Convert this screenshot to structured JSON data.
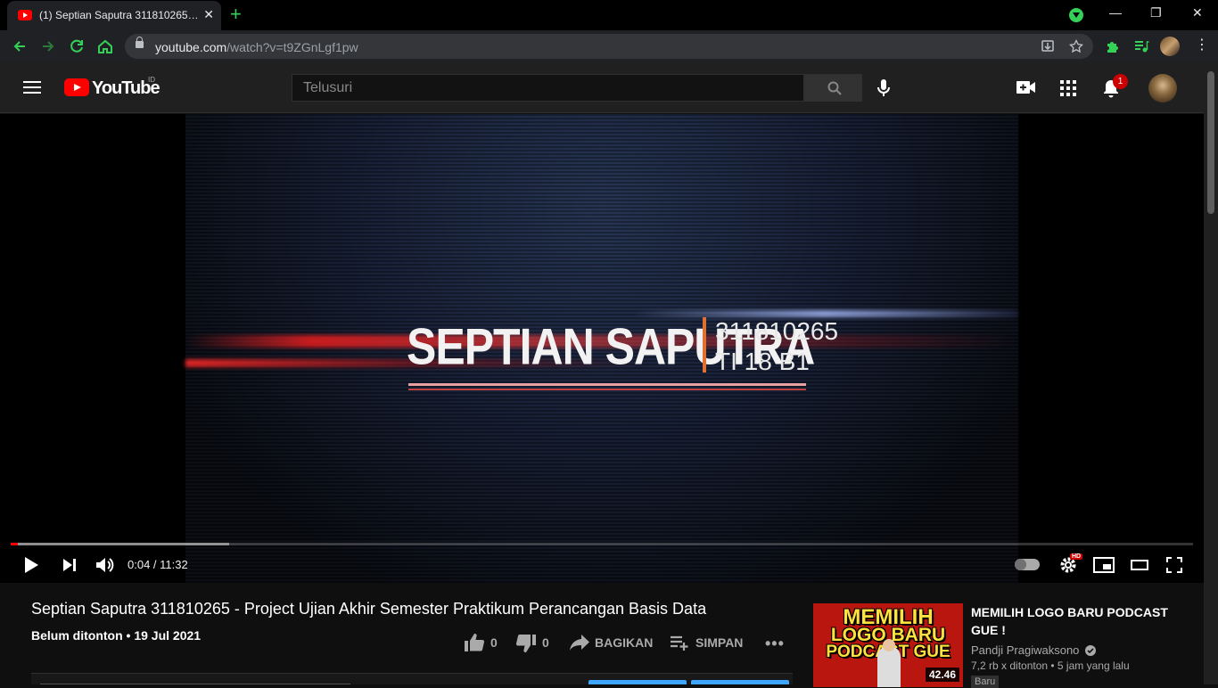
{
  "browser": {
    "tab_title": "(1) Septian Saputra 311810265 - P",
    "url_host": "youtube.com",
    "url_path": "/watch?v=t9ZGnLgf1pw",
    "new_tab": "+",
    "close": "✕",
    "minimize": "—",
    "restore": "❐",
    "close_window": "✕"
  },
  "masthead": {
    "logo_text": "YouTube",
    "country": "ID",
    "search_placeholder": "Telusuri",
    "notification_count": "1"
  },
  "video": {
    "overlay_name": "SEPTIAN SAPUTRA",
    "overlay_nim": "311810265",
    "overlay_class": "TI 18 B1",
    "current_time": "0:04",
    "duration": "11:32",
    "progress_played": 0.006,
    "progress_buffered": 0.185
  },
  "info": {
    "title": "Septian Saputra 311810265 - Project Ujian Akhir Semester Praktikum Perancangan Basis Data",
    "views": "Belum ditonton",
    "date": "19 Jul 2021",
    "likes": "0",
    "dislikes": "0",
    "share_label": "BAGIKAN",
    "save_label": "SIMPAN"
  },
  "recommendation": {
    "thumb_line1": "MEMILIH",
    "thumb_line2": "LOGO BARU",
    "thumb_line3": "PODCAST GUE",
    "duration": "42.46",
    "title": "MEMILIH LOGO BARU PODCAST GUE !",
    "channel": "Pandji Pragiwaksono",
    "stats": "7,2 rb x ditonton • 5 jam yang lalu",
    "badge": "Baru"
  },
  "colors": {
    "accent_red": "#ff0000",
    "chrome_green": "#34d058",
    "link_blue": "#3ea6ff"
  }
}
